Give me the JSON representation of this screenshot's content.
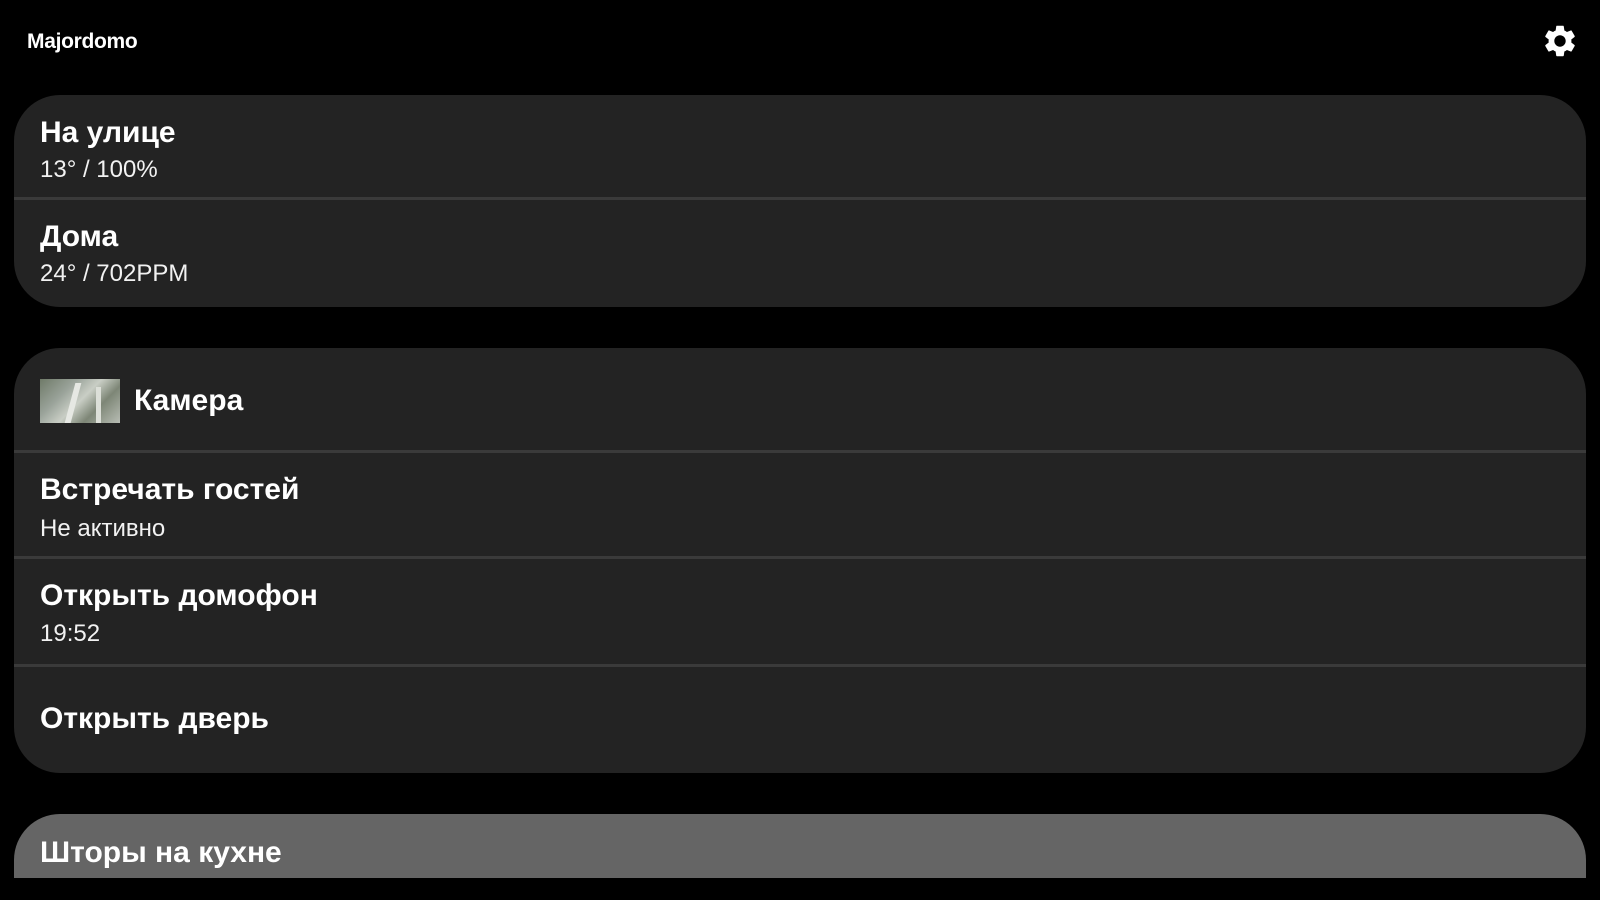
{
  "app": {
    "title": "Majordomo",
    "settings_icon": "gear-icon"
  },
  "weather": {
    "outside": {
      "title": "На улице",
      "value": "13° / 100%"
    },
    "home": {
      "title": "Дома",
      "value": "24° / 702PPM"
    }
  },
  "door": {
    "camera": {
      "label": "Камера",
      "thumbnail_icon": "camera-snapshot"
    },
    "greet_guests": {
      "title": "Встречать гостей",
      "status": "Не активно"
    },
    "intercom": {
      "title": "Открыть домофон",
      "time": "19:52"
    },
    "open_door": {
      "title": "Открыть дверь"
    }
  },
  "blinds": {
    "title": "Шторы на кухне"
  },
  "colors": {
    "background": "#000000",
    "card": "#232323",
    "divider": "#3a3a3a",
    "card_inactive": "#656565",
    "text": "#ffffff"
  }
}
